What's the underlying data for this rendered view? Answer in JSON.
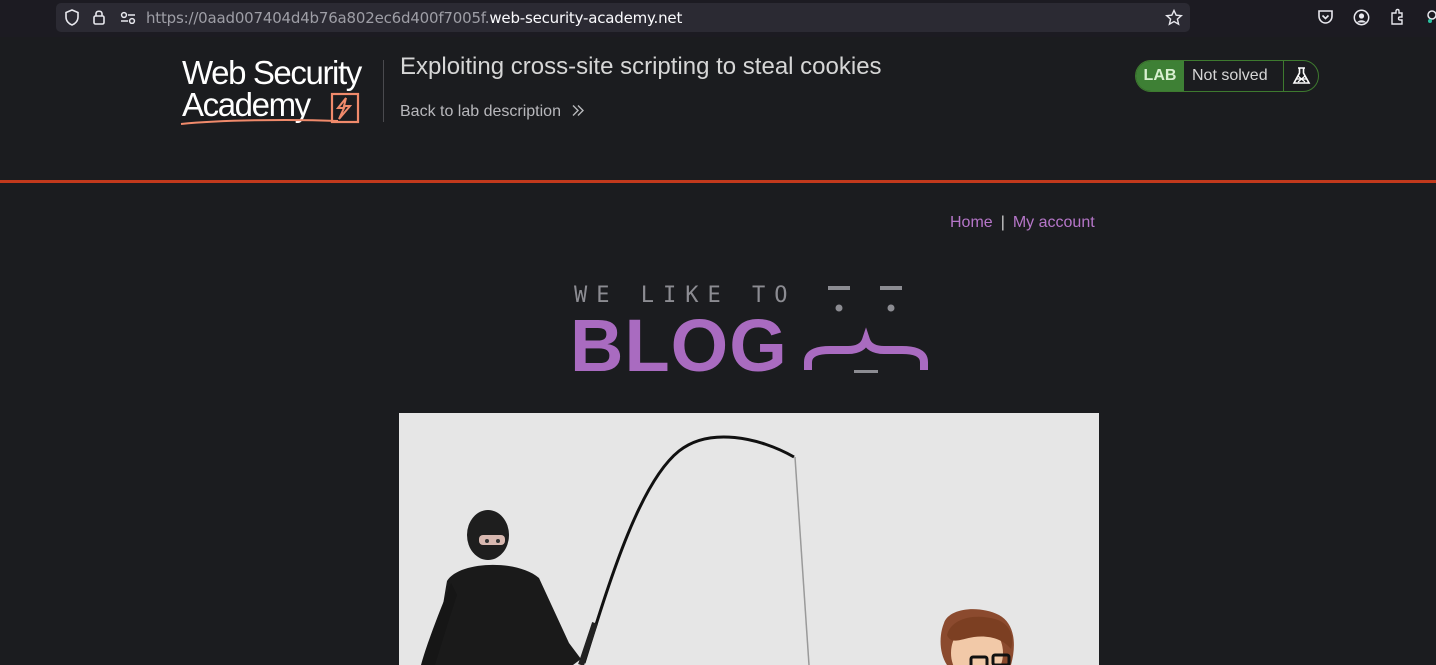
{
  "browser": {
    "url_prefix": "https://0aad007404d4b76a802ec6d400f7005f.",
    "url_host": "web-security-academy.net",
    "icons": [
      "shield-icon",
      "lock-icon",
      "permissions-icon",
      "star-icon",
      "pocket-icon",
      "account-icon",
      "extensions-icon"
    ]
  },
  "lab": {
    "logo_line1": "Web Security",
    "logo_line2": "Academy",
    "title": "Exploiting cross-site scripting to steal cookies",
    "back_link": "Back to lab description",
    "badge": "LAB",
    "status": "Not solved",
    "colors": {
      "accent": "#c1391c",
      "status_green": "#3e8035"
    }
  },
  "nav": {
    "home": "Home",
    "separator": "|",
    "account": "My account",
    "link_color": "#b676c9"
  },
  "banner": {
    "top_text": "WE LIKE TO",
    "main_text": "BLOG",
    "color": "#a96bc0"
  }
}
